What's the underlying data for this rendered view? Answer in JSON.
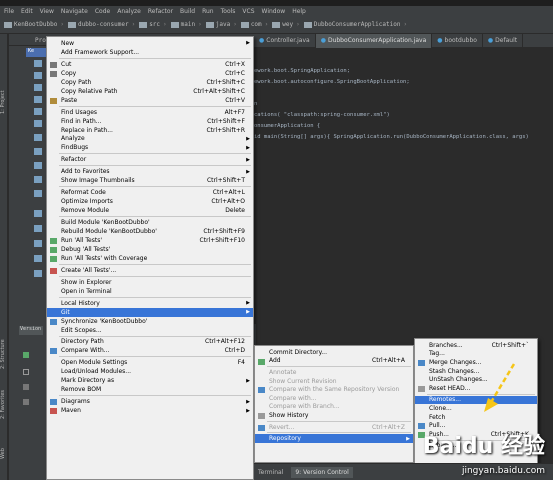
{
  "navbar": {
    "crumbs": [
      "KenBootDubbo",
      "dubbo-consumer",
      "src",
      "main",
      "java",
      "com",
      "wey",
      "DubboConsumerApplication"
    ]
  },
  "menubar": [
    "File",
    "Edit",
    "View",
    "Navigate",
    "Code",
    "Analyze",
    "Refactor",
    "Build",
    "Run",
    "Tools",
    "VCS",
    "Window",
    "Help"
  ],
  "left_tools": {
    "project": "1: Project",
    "structure": "2: Structure",
    "favorites": "2: Favorites",
    "web": "Web"
  },
  "project_header": {
    "label": "Proj",
    "root": "Ke"
  },
  "editor_tabs": [
    "Controller.java",
    "DubboConsumerApplication.java",
    "bootdubbo",
    "Default"
  ],
  "code_lines": [
    "ework.boot.SpringApplication;",
    "ework.boot.autoconfigure.SpringBootApplication;",
    "",
    "n",
    "cations( \"classpath:spring-consumer.xml\")",
    "onsumerApplication {",
    "id main(String[] args){ SpringApplication.run(DubboConsumerApplication.class, args)"
  ],
  "version_tab": "Version",
  "main_menu": [
    {
      "label": "New",
      "shortcut": "",
      "arrow": true,
      "icon": ""
    },
    {
      "label": "Add Framework Support...",
      "shortcut": "",
      "arrow": false,
      "icon": ""
    },
    {
      "sep": true
    },
    {
      "label": "Cut",
      "shortcut": "Ctrl+X",
      "icon": "cut-icon"
    },
    {
      "label": "Copy",
      "shortcut": "Ctrl+C",
      "icon": "copy-icon"
    },
    {
      "label": "Copy Path",
      "shortcut": "Ctrl+Shift+C",
      "icon": ""
    },
    {
      "label": "Copy Relative Path",
      "shortcut": "Ctrl+Alt+Shift+C",
      "icon": ""
    },
    {
      "label": "Paste",
      "shortcut": "Ctrl+V",
      "icon": "paste-icon"
    },
    {
      "sep": true
    },
    {
      "label": "Find Usages",
      "shortcut": "Alt+F7",
      "icon": ""
    },
    {
      "label": "Find in Path...",
      "shortcut": "Ctrl+Shift+F",
      "icon": ""
    },
    {
      "label": "Replace in Path...",
      "shortcut": "Ctrl+Shift+R",
      "icon": ""
    },
    {
      "label": "Analyze",
      "shortcut": "",
      "arrow": true,
      "icon": ""
    },
    {
      "label": "FindBugs",
      "shortcut": "",
      "arrow": true,
      "icon": ""
    },
    {
      "sep": true
    },
    {
      "label": "Refactor",
      "shortcut": "",
      "arrow": true,
      "icon": ""
    },
    {
      "sep": true
    },
    {
      "label": "Add to Favorites",
      "shortcut": "",
      "arrow": true,
      "icon": ""
    },
    {
      "label": "Show Image Thumbnails",
      "shortcut": "Ctrl+Shift+T",
      "icon": ""
    },
    {
      "sep": true
    },
    {
      "label": "Reformat Code",
      "shortcut": "Ctrl+Alt+L",
      "icon": ""
    },
    {
      "label": "Optimize Imports",
      "shortcut": "Ctrl+Alt+O",
      "icon": ""
    },
    {
      "label": "Remove Module",
      "shortcut": "Delete",
      "icon": ""
    },
    {
      "sep": true
    },
    {
      "label": "Build Module 'KenBootDubbo'",
      "shortcut": "",
      "icon": ""
    },
    {
      "label": "Rebuild Module 'KenBootDubbo'",
      "shortcut": "Ctrl+Shift+F9",
      "icon": ""
    },
    {
      "label": "Run 'All Tests'",
      "shortcut": "Ctrl+Shift+F10",
      "icon": "run-icon"
    },
    {
      "label": "Debug 'All Tests'",
      "shortcut": "",
      "icon": "debug-icon"
    },
    {
      "label": "Run 'All Tests' with Coverage",
      "shortcut": "",
      "icon": "coverage-icon"
    },
    {
      "sep": true
    },
    {
      "label": "Create 'All Tests'...",
      "shortcut": "",
      "icon": "create-test-icon"
    },
    {
      "sep": true
    },
    {
      "label": "Show in Explorer",
      "shortcut": "",
      "icon": ""
    },
    {
      "label": "Open in Terminal",
      "shortcut": "",
      "icon": ""
    },
    {
      "sep": true
    },
    {
      "label": "Local History",
      "shortcut": "",
      "arrow": true,
      "icon": ""
    },
    {
      "label": "Git",
      "shortcut": "",
      "arrow": true,
      "icon": "",
      "highlight": true
    },
    {
      "label": "Synchronize 'KenBootDubbo'",
      "shortcut": "",
      "icon": "sync-icon"
    },
    {
      "label": "Edit Scopes...",
      "shortcut": "",
      "icon": ""
    },
    {
      "sep": true
    },
    {
      "label": "Directory Path",
      "shortcut": "Ctrl+Alt+F12",
      "icon": ""
    },
    {
      "label": "Compare With...",
      "shortcut": "Ctrl+D",
      "icon": "compare-icon"
    },
    {
      "sep": true
    },
    {
      "label": "Open Module Settings",
      "shortcut": "F4",
      "icon": ""
    },
    {
      "label": "Load/Unload Modules...",
      "shortcut": "",
      "icon": ""
    },
    {
      "label": "Mark Directory as",
      "shortcut": "",
      "arrow": true,
      "icon": ""
    },
    {
      "label": "Remove BOM",
      "shortcut": "",
      "icon": ""
    },
    {
      "sep": true
    },
    {
      "label": "Diagrams",
      "shortcut": "",
      "arrow": true,
      "icon": "diagram-icon"
    },
    {
      "label": "Maven",
      "shortcut": "",
      "arrow": true,
      "icon": "maven-icon"
    }
  ],
  "git_menu": [
    {
      "label": "Commit Directory...",
      "shortcut": "",
      "icon": ""
    },
    {
      "label": "Add",
      "shortcut": "Ctrl+Alt+A",
      "icon": "add-icon"
    },
    {
      "sep": true
    },
    {
      "label": "Annotate",
      "shortcut": "",
      "disabled": true
    },
    {
      "label": "Show Current Revision",
      "shortcut": "",
      "disabled": true
    },
    {
      "label": "Compare with the Same Repository Version",
      "shortcut": "",
      "disabled": true,
      "icon": "compare-icon"
    },
    {
      "label": "Compare with...",
      "shortcut": "",
      "disabled": true
    },
    {
      "label": "Compare with Branch...",
      "shortcut": "",
      "disabled": true
    },
    {
      "label": "Show History",
      "shortcut": "",
      "icon": "history-icon"
    },
    {
      "sep": true
    },
    {
      "label": "Revert...",
      "shortcut": "Ctrl+Alt+Z",
      "disabled": true,
      "icon": "revert-icon"
    },
    {
      "sep": true
    },
    {
      "label": "Repository",
      "shortcut": "",
      "arrow": true,
      "highlight": true
    }
  ],
  "repo_menu": [
    {
      "label": "Branches...",
      "shortcut": "Ctrl+Shift+`"
    },
    {
      "label": "Tag..."
    },
    {
      "label": "Merge Changes...",
      "icon": "merge-icon"
    },
    {
      "label": "Stash Changes..."
    },
    {
      "label": "UnStash Changes..."
    },
    {
      "label": "Reset HEAD...",
      "icon": "reset-icon"
    },
    {
      "sep": true
    },
    {
      "label": "Remotes...",
      "highlight": true
    },
    {
      "label": "Clone..."
    },
    {
      "label": "Fetch"
    },
    {
      "label": "Pull...",
      "icon": "pull-icon"
    },
    {
      "label": "Push...",
      "shortcut": "Ctrl+Shift+K",
      "icon": "push-icon"
    },
    {
      "sep": true
    },
    {
      "label": "Rebase..."
    }
  ],
  "bottom_tabs": {
    "terminal": "Terminal",
    "version_control": "9: Version Control"
  },
  "watermark": {
    "brand": "Baidu 经验",
    "url": "jingyan.baidu.com"
  },
  "colors": {
    "highlight": "#3875d7",
    "arrow": "#f5c518",
    "menu_bg": "#f0f0f0"
  }
}
